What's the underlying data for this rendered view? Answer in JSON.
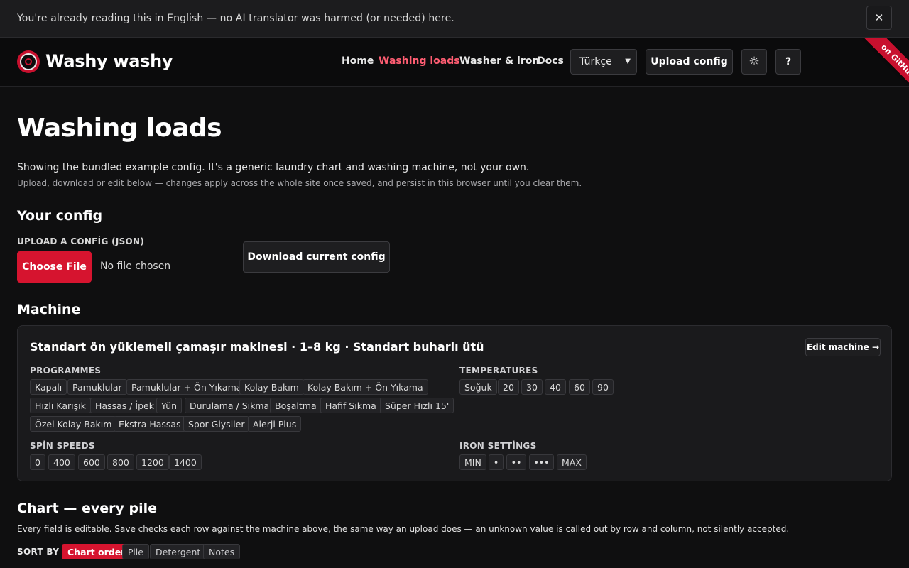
{
  "banner": {
    "text": "You're already reading this in English — no AI translator was harmed (or needed) here.",
    "close_icon": "✕"
  },
  "header": {
    "brand": "Washy washy",
    "nav": [
      {
        "label": "Home",
        "active": false
      },
      {
        "label": "Washing loads",
        "active": true
      },
      {
        "label": "Washer & iron",
        "active": false
      },
      {
        "label": "Docs",
        "active": false
      }
    ],
    "language_selected": "Türkçe",
    "upload_config_label": "Upload config",
    "theme_icon": "☼",
    "help_label": "?",
    "ribbon_text": "on GitHub"
  },
  "page": {
    "title": "Washing loads",
    "intro": "Showing the bundled example config. It's a generic laundry chart and washing machine, not your own.",
    "intro_sub": "Upload, download or edit below — changes apply across the whole site once saved, and persist in this browser until you clear them."
  },
  "config": {
    "heading": "Your config",
    "upload_label": "UPLOAD A CONFİG (JSON)",
    "choose_file_label": "Choose File",
    "no_file_text": "No file chosen",
    "download_label": "Download current config"
  },
  "machine": {
    "heading": "Machine",
    "title": "Standart ön yüklemeli çamaşır makinesi · 1–8 kg · Standart buharlı ütü",
    "edit_label": "Edit machine →",
    "programmes_label": "PROGRAMMES",
    "programmes": [
      "Kapalı",
      "Pamuklular",
      "Pamuklular + Ön Yıkama",
      "Kolay Bakım",
      "Kolay Bakım + Ön Yıkama",
      "Hızlı Karışık",
      "Hassas / İpek",
      "Yün",
      "Durulama / Sıkma",
      "Boşaltma",
      "Hafif Sıkma",
      "Süper Hızlı 15'",
      "Özel Kolay Bakım",
      "Ekstra Hassas",
      "Spor Giysiler",
      "Alerji Plus"
    ],
    "temperatures_label": "TEMPERATURES",
    "temperatures": [
      "Soğuk",
      "20",
      "30",
      "40",
      "60",
      "90"
    ],
    "spin_label": "SPİN SPEEDS",
    "spin_speeds": [
      "0",
      "400",
      "600",
      "800",
      "1200",
      "1400"
    ],
    "iron_label": "IRON SETTİNGS",
    "iron_settings": [
      "MIN",
      "•",
      "••",
      "•••",
      "MAX"
    ]
  },
  "chart": {
    "heading": "Chart — every pile",
    "note": "Every field is editable. Save checks each row against the machine above, the same way an upload does — an unknown value is called out by row and column, not silently accepted.",
    "sort_label": "SORT BY",
    "sort_options": [
      {
        "label": "Chart order",
        "active": true
      },
      {
        "label": "Pile",
        "active": false
      },
      {
        "label": "Detergent",
        "active": false
      },
      {
        "label": "Notes",
        "active": false
      }
    ]
  }
}
